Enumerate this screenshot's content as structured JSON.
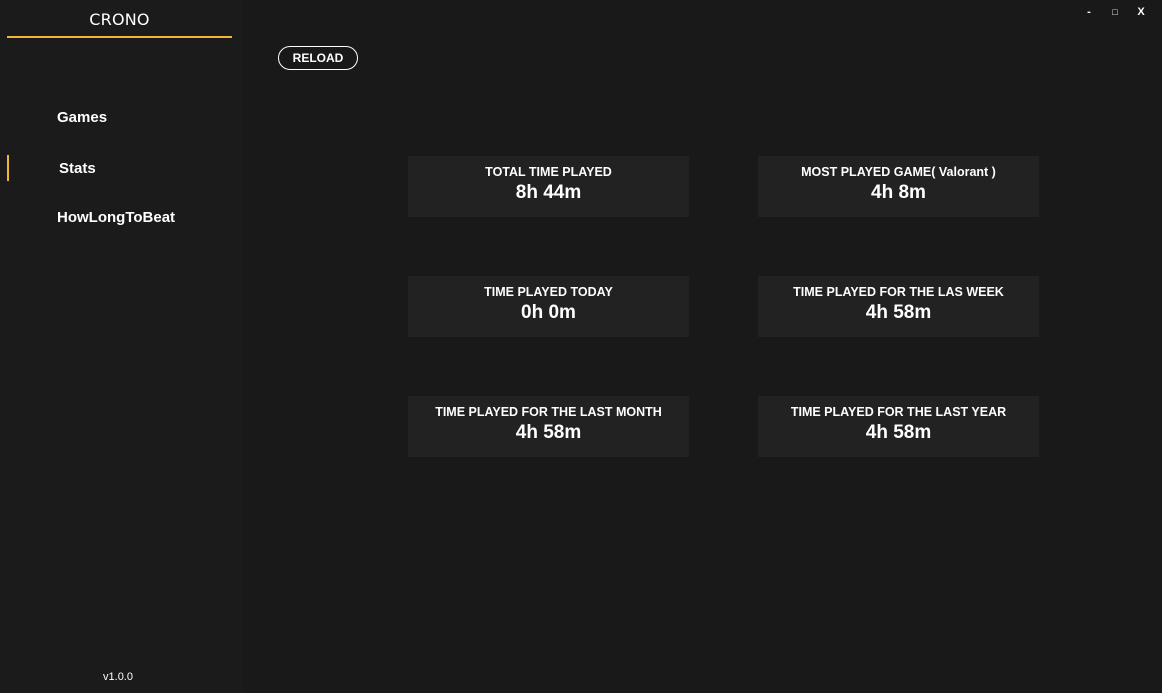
{
  "app": {
    "title": "CRONO",
    "version": "v1.0.0"
  },
  "window_controls": {
    "minimize": "-",
    "maximize": "□",
    "close": "X"
  },
  "sidebar": {
    "items": [
      {
        "label": "Games",
        "active": false
      },
      {
        "label": "Stats",
        "active": true
      },
      {
        "label": "HowLongToBeat",
        "active": false
      }
    ]
  },
  "toolbar": {
    "reload_label": "RELOAD"
  },
  "stats": [
    {
      "label": "TOTAL TIME PLAYED",
      "value": "8h 44m"
    },
    {
      "label": "MOST PLAYED GAME( Valorant )",
      "value": "4h 8m"
    },
    {
      "label": "TIME PLAYED TODAY",
      "value": "0h 0m"
    },
    {
      "label": "TIME PLAYED FOR THE LAS WEEK",
      "value": "4h 58m"
    },
    {
      "label": "TIME PLAYED FOR THE LAST MONTH",
      "value": "4h 58m"
    },
    {
      "label": "TIME PLAYED FOR THE LAST YEAR",
      "value": "4h 58m"
    }
  ],
  "colors": {
    "accent": "#f2b632",
    "background": "#191919",
    "card": "#222222",
    "text": "#ffffff"
  }
}
